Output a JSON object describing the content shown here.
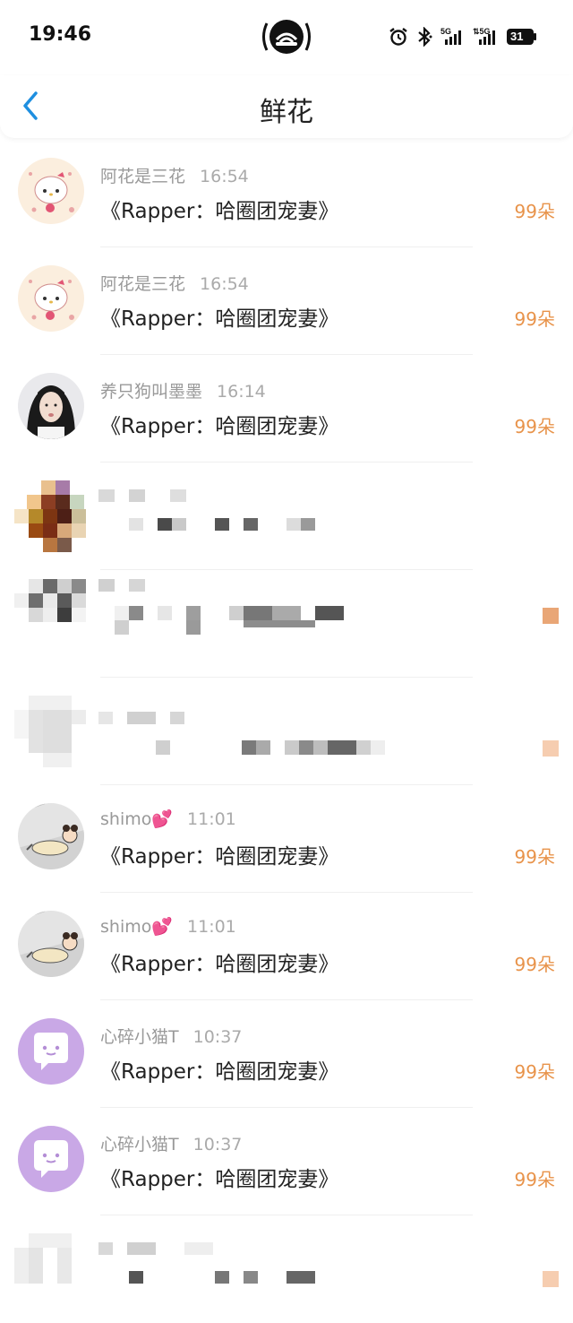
{
  "status_bar": {
    "time": "19:46",
    "battery": "31"
  },
  "nav": {
    "title": "鲜花"
  },
  "messages": [
    {
      "sender": "阿花是三花",
      "time": "16:54",
      "text": "《Rapper：哈圈团宠妻》",
      "amount": "99朵"
    },
    {
      "sender": "阿花是三花",
      "time": "16:54",
      "text": "《Rapper：哈圈团宠妻》",
      "amount": "99朵"
    },
    {
      "sender": "养只狗叫墨墨",
      "time": "16:14",
      "text": "《Rapper：哈圈团宠妻》",
      "amount": "99朵"
    },
    {
      "sender": "shimo💕",
      "time": "11:01",
      "text": "《Rapper：哈圈团宠妻》",
      "amount": "99朵"
    },
    {
      "sender": "shimo💕",
      "time": "11:01",
      "text": "《Rapper：哈圈团宠妻》",
      "amount": "99朵"
    },
    {
      "sender": "心碎小猫T",
      "time": "10:37",
      "text": "《Rapper：哈圈团宠妻》",
      "amount": "99朵"
    },
    {
      "sender": "心碎小猫T",
      "time": "10:37",
      "text": "《Rapper：哈圈团宠妻》",
      "amount": "99朵"
    }
  ],
  "colors": {
    "amount": "#e8934a",
    "back": "#1e8fe0",
    "sender": "#999999"
  }
}
